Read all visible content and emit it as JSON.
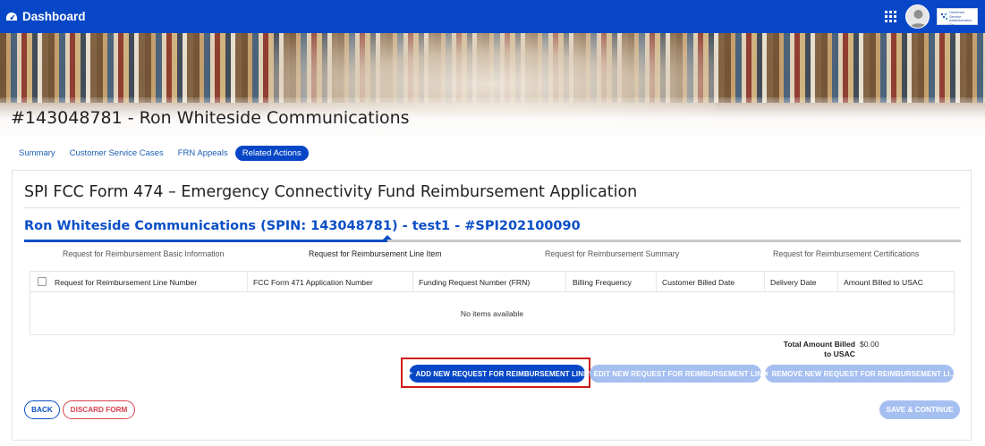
{
  "header": {
    "brand_label": "Dashboard",
    "logo_text": "Universal Service Administrative Co."
  },
  "page": {
    "title": "#143048781 - Ron Whiteside Communications"
  },
  "tabs": [
    {
      "label": "Summary",
      "active": false
    },
    {
      "label": "Customer Service Cases",
      "active": false
    },
    {
      "label": "FRN Appeals",
      "active": false
    },
    {
      "label": "Related Actions",
      "active": true
    }
  ],
  "form": {
    "title": "SPI FCC Form 474 – Emergency Connectivity Fund Reimbursement Application",
    "subtitle": "Ron Whiteside Communications (SPIN: 143048781) - test1 - #SPI202100090",
    "steps": [
      {
        "label": "Request for Reimbursement Basic Information",
        "state": "complete"
      },
      {
        "label": "Request for Reimbursement Line Item",
        "state": "current"
      },
      {
        "label": "Request for Reimbursement Summary",
        "state": "upcoming"
      },
      {
        "label": "Request for Reimbursement Certifications",
        "state": "upcoming"
      }
    ],
    "table": {
      "columns": [
        "Request for Reimbursement Line Number",
        "FCC Form 471 Application Number",
        "Funding Request Number (FRN)",
        "Billing Frequency",
        "Customer Billed Date",
        "Delivery Date",
        "Amount Billed to USAC"
      ],
      "rows": [],
      "empty_text": "No items available"
    },
    "total": {
      "label_line1": "Total Amount Billed",
      "label_line2": "to USAC",
      "value": "$0.00"
    },
    "actions": {
      "add_label": "ADD NEW REQUEST FOR REIMBURSEMENT LINE",
      "edit_label": "EDIT NEW REQUEST FOR REIMBURSEMENT LINE",
      "remove_label": "REMOVE NEW REQUEST FOR REIMBURSEMENT LI..."
    },
    "footer": {
      "back_label": "BACK",
      "discard_label": "DISCARD FORM",
      "save_label": "SAVE & CONTINUE"
    }
  },
  "colors": {
    "primary": "#0747c7",
    "disabled": "#a5bff0",
    "danger": "#d7434f",
    "highlight": "#d11a1a"
  }
}
